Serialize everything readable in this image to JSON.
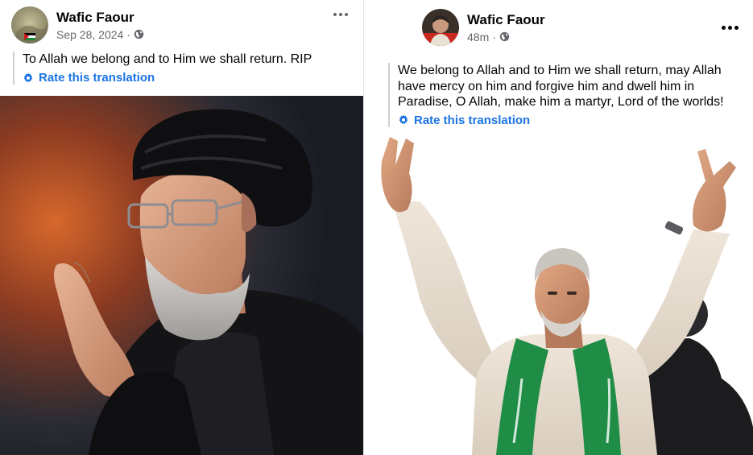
{
  "left_post": {
    "author": "Wafic Faour",
    "date": "Sep 28, 2024",
    "separator": "·",
    "text": "To Allah we belong and to Him we shall return. RIP",
    "rate_label": "Rate this translation",
    "privacy_icon": "globe-icon",
    "more_icon": "more-options-icon"
  },
  "right_post": {
    "author": "Wafic Faour",
    "date": "48m",
    "separator": "·",
    "text": "We belong to Allah and to Him we shall return, may Allah have mercy on him and forgive him and dwell him in Paradise, O Allah, make him a martyr, Lord of the worlds!",
    "rate_label": "Rate this translation",
    "privacy_icon": "globe-icon",
    "more_icon": "more-options-icon"
  },
  "colors": {
    "link_blue": "#1b74e4",
    "secondary_text": "#65676b",
    "quote_bar": "#ced0d4"
  }
}
